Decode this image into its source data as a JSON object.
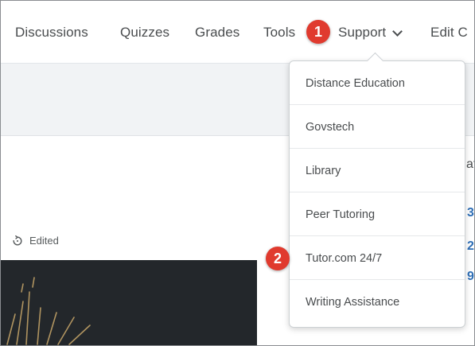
{
  "nav": {
    "items": [
      "Discussions",
      "Quizzes",
      "Grades",
      "Tools"
    ],
    "support_label": "Support",
    "edit_label": "Edit C"
  },
  "dropdown": {
    "items": [
      "Distance Education",
      "Govstech",
      "Library",
      "Peer Tutoring",
      "Tutor.com 24/7",
      "Writing Assistance"
    ]
  },
  "content": {
    "edited_label": "Edited",
    "right_fragments": [
      "at",
      "3",
      "2",
      "9"
    ]
  },
  "badges": [
    "1",
    "2"
  ],
  "colors": {
    "badge": "#e03a2e",
    "link": "#2f6fb6",
    "text": "#494c4e"
  }
}
